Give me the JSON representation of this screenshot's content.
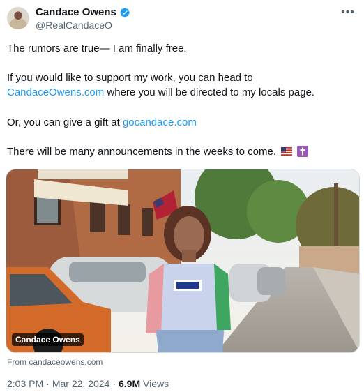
{
  "author": {
    "name": "Candace Owens",
    "handle": "@RealCandaceO",
    "verified": true
  },
  "more_icon": "more-horizontal-icon",
  "body": {
    "line1": "The rumors are true— I am finally free.",
    "line2": "If you would like to support my work, you can head to",
    "line3_link": "CandaceOwens.com",
    "line3_rest": " where you will be directed to my locals page.",
    "line4_pre": "Or, you can give a gift at ",
    "line4_link": "gocandace.com",
    "line5": "There will be many announcements in the weeks to come.",
    "emojis": [
      "us-flag-emoji",
      "latin-cross-emoji"
    ]
  },
  "media": {
    "label": "Candace Owens",
    "source": "From candaceowens.com"
  },
  "meta": {
    "time": "2:03 PM",
    "sep1": "·",
    "date": "Mar 22, 2024",
    "sep2": "·",
    "views_count": "6.9M",
    "views_label": "Views"
  },
  "colors": {
    "link": "#1d9bf0",
    "secondary_text": "#536471",
    "verified_badge": "#1d9bf0"
  }
}
